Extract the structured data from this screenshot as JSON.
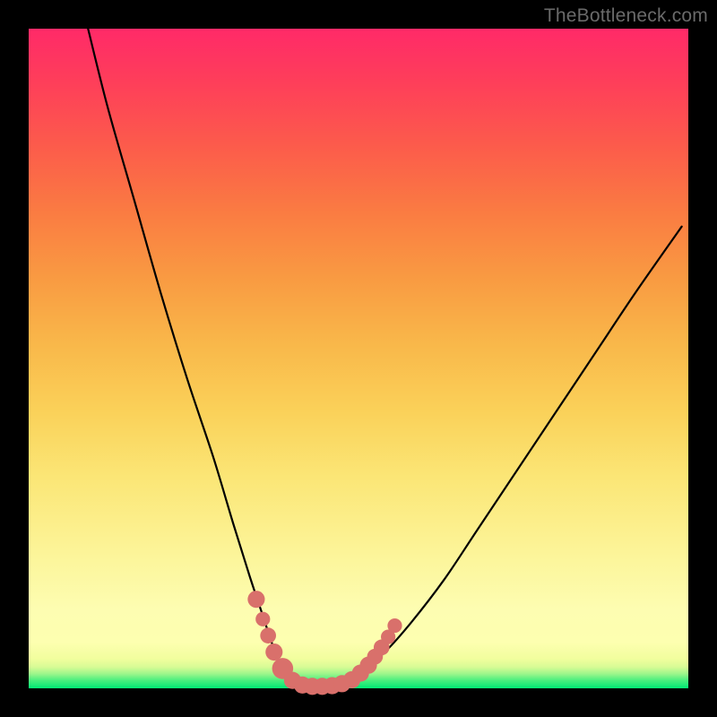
{
  "watermark": "TheBottleneck.com",
  "chart_data": {
    "type": "line",
    "title": "",
    "xlabel": "",
    "ylabel": "",
    "xlim": [
      0,
      100
    ],
    "ylim": [
      0,
      100
    ],
    "series": [
      {
        "name": "bottleneck-curve",
        "x": [
          9,
          12,
          16,
          20,
          24,
          28,
          31,
          33.5,
          35.5,
          37,
          38.5,
          40,
          42,
          44,
          46,
          48,
          50,
          54,
          58,
          63,
          68,
          74,
          80,
          86,
          92,
          99
        ],
        "values": [
          100,
          88,
          74,
          60,
          47,
          35,
          25,
          17,
          11,
          6.5,
          3,
          1.2,
          0.4,
          0.2,
          0.3,
          0.8,
          2,
          5.5,
          10,
          16.5,
          24,
          33,
          42,
          51,
          60,
          70
        ]
      }
    ],
    "markers": {
      "name": "highlight-dots",
      "color": "#d9706b",
      "points": [
        {
          "x": 34.5,
          "y": 13.5,
          "r": 1.3
        },
        {
          "x": 35.5,
          "y": 10.5,
          "r": 1.1
        },
        {
          "x": 36.3,
          "y": 8.0,
          "r": 1.2
        },
        {
          "x": 37.2,
          "y": 5.5,
          "r": 1.3
        },
        {
          "x": 38.5,
          "y": 3.0,
          "r": 1.6
        },
        {
          "x": 40.0,
          "y": 1.2,
          "r": 1.3
        },
        {
          "x": 41.5,
          "y": 0.5,
          "r": 1.3
        },
        {
          "x": 43.0,
          "y": 0.3,
          "r": 1.3
        },
        {
          "x": 44.5,
          "y": 0.3,
          "r": 1.3
        },
        {
          "x": 46.0,
          "y": 0.4,
          "r": 1.3
        },
        {
          "x": 47.5,
          "y": 0.7,
          "r": 1.3
        },
        {
          "x": 49.0,
          "y": 1.3,
          "r": 1.3
        },
        {
          "x": 50.3,
          "y": 2.3,
          "r": 1.3
        },
        {
          "x": 51.5,
          "y": 3.5,
          "r": 1.3
        },
        {
          "x": 52.5,
          "y": 4.8,
          "r": 1.2
        },
        {
          "x": 53.5,
          "y": 6.2,
          "r": 1.2
        },
        {
          "x": 54.5,
          "y": 7.8,
          "r": 1.1
        },
        {
          "x": 55.5,
          "y": 9.5,
          "r": 1.1
        }
      ]
    }
  }
}
